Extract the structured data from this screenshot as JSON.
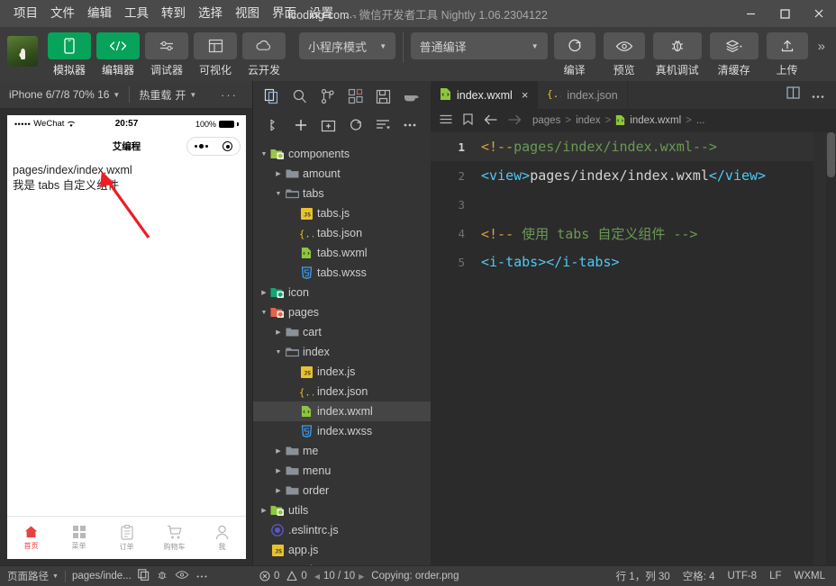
{
  "titlebar": {
    "menus": [
      "项目",
      "文件",
      "编辑",
      "工具",
      "转到",
      "选择",
      "视图",
      "界面",
      "设置"
    ],
    "menu_overflow": "...",
    "project": "icoding-com",
    "separator": "-",
    "app_name": "微信开发者工具",
    "channel": "Nightly",
    "version": "1.06.2304122",
    "minimize": "minimize-icon",
    "maximize": "maximize-icon",
    "close": "close-icon"
  },
  "toolbar": {
    "avatar": "user-avatar",
    "left_tools": [
      {
        "label": "模拟器",
        "icon": "phone-icon",
        "active": true
      },
      {
        "label": "编辑器",
        "icon": "code-icon",
        "active": true
      },
      {
        "label": "调试器",
        "icon": "debugger-icon",
        "active": false
      },
      {
        "label": "可视化",
        "icon": "layout-icon",
        "active": false
      },
      {
        "label": "云开发",
        "icon": "cloud-icon",
        "active": false
      }
    ],
    "mode_select": "小程序模式",
    "compile_select": "普通编译",
    "right_tools": [
      {
        "label": "编译",
        "icon": "refresh-icon"
      },
      {
        "label": "预览",
        "icon": "eye-icon"
      },
      {
        "label": "真机调试",
        "icon": "bug-icon"
      },
      {
        "label": "清缓存",
        "icon": "layers-icon"
      },
      {
        "label": "上传",
        "icon": "upload-icon"
      }
    ],
    "overflow": "»"
  },
  "simulator": {
    "device": "iPhone 6/7/8 70% 16",
    "hot_reload_label": "热重载",
    "hot_reload_value": "开",
    "more": "···",
    "phone": {
      "carrier": "WeChat",
      "signal_dots": "•••••",
      "time": "20:57",
      "battery": "100%",
      "nav_title": "艾编程",
      "content_lines": [
        "pages/index/index.wxml",
        "我是 tabs 自定义组件"
      ],
      "tabbar": [
        {
          "label": "首页",
          "icon": "home-icon",
          "active": true
        },
        {
          "label": "菜单",
          "icon": "grid-icon",
          "active": false
        },
        {
          "label": "订单",
          "icon": "clipboard-icon",
          "active": false
        },
        {
          "label": "购物车",
          "icon": "cart-icon",
          "active": false
        },
        {
          "label": "我",
          "icon": "person-icon",
          "active": false
        }
      ]
    }
  },
  "explorer": {
    "activity_icons": [
      "files-icon",
      "search-icon",
      "source-control-icon",
      "extensions-icon",
      "save-icon",
      "docker-icon"
    ],
    "operation_icons": [
      "new-file-icon",
      "add-icon",
      "new-folder-icon",
      "refresh-icon",
      "collapse-icon",
      "more-icon"
    ],
    "tree": [
      {
        "label": "components",
        "type": "folder-special",
        "depth": 0,
        "state": "open",
        "color": "#9ec34b"
      },
      {
        "label": "amount",
        "type": "folder",
        "depth": 1,
        "state": "closed",
        "color": "#8a9199"
      },
      {
        "label": "tabs",
        "type": "folder-open",
        "depth": 1,
        "state": "open",
        "color": "#8a9199"
      },
      {
        "label": "tabs.js",
        "type": "js",
        "depth": 2,
        "state": "leaf",
        "color": "#e8c22e"
      },
      {
        "label": "tabs.json",
        "type": "json",
        "depth": 2,
        "state": "leaf",
        "color": "#e8c22e"
      },
      {
        "label": "tabs.wxml",
        "type": "wxml",
        "depth": 2,
        "state": "leaf",
        "color": "#8dc63f"
      },
      {
        "label": "tabs.wxss",
        "type": "wxss",
        "depth": 2,
        "state": "leaf",
        "color": "#3c9ff0"
      },
      {
        "label": "icon",
        "type": "folder-special",
        "depth": 0,
        "state": "closed",
        "color": "#12a474"
      },
      {
        "label": "pages",
        "type": "folder-special",
        "depth": 0,
        "state": "open",
        "color": "#e2634a"
      },
      {
        "label": "cart",
        "type": "folder",
        "depth": 1,
        "state": "closed",
        "color": "#8a9199"
      },
      {
        "label": "index",
        "type": "folder-open",
        "depth": 1,
        "state": "open",
        "color": "#8a9199"
      },
      {
        "label": "index.js",
        "type": "js",
        "depth": 2,
        "state": "leaf",
        "color": "#e8c22e"
      },
      {
        "label": "index.json",
        "type": "json",
        "depth": 2,
        "state": "leaf",
        "color": "#e8c22e"
      },
      {
        "label": "index.wxml",
        "type": "wxml",
        "depth": 2,
        "state": "leaf",
        "color": "#8dc63f",
        "selected": true
      },
      {
        "label": "index.wxss",
        "type": "wxss",
        "depth": 2,
        "state": "leaf",
        "color": "#3c9ff0"
      },
      {
        "label": "me",
        "type": "folder",
        "depth": 1,
        "state": "closed",
        "color": "#8a9199"
      },
      {
        "label": "menu",
        "type": "folder",
        "depth": 1,
        "state": "closed",
        "color": "#8a9199"
      },
      {
        "label": "order",
        "type": "folder",
        "depth": 1,
        "state": "closed",
        "color": "#8a9199"
      },
      {
        "label": "utils",
        "type": "folder-special",
        "depth": 0,
        "state": "closed",
        "color": "#8dc63f"
      },
      {
        "label": ".eslintrc.js",
        "type": "eslint",
        "depth": 0,
        "state": "leaf",
        "color": "#5b57c4"
      },
      {
        "label": "app.js",
        "type": "js",
        "depth": 0,
        "state": "leaf",
        "color": "#e8c22e"
      },
      {
        "label": "app.json",
        "type": "json",
        "depth": 0,
        "state": "leaf",
        "color": "#e8c22e"
      }
    ]
  },
  "editor": {
    "tabs": [
      {
        "label": "index.wxml",
        "icon": "wxml-icon",
        "active": true,
        "close": "×"
      },
      {
        "label": "index.json",
        "icon": "json-icon",
        "active": false,
        "close": ""
      }
    ],
    "tab_actions": [
      "split-editor-icon",
      "more-actions-icon"
    ],
    "breadcrumb_icons": [
      "outline-icon",
      "bookmark-icon",
      "back-icon",
      "forward-icon"
    ],
    "breadcrumb": [
      "pages",
      "index",
      "index.wxml",
      "..."
    ],
    "lines": [
      {
        "num": "1",
        "tokens": [
          {
            "t": "<!--",
            "c": "t-commark"
          },
          {
            "t": "pages/index/index.wxml",
            "c": "t-comment"
          },
          {
            "t": "-->",
            "c": "t-comment"
          }
        ],
        "current": true
      },
      {
        "num": "2",
        "tokens": [
          {
            "t": "<view>",
            "c": "t-tag"
          },
          {
            "t": "pages/index/index.wxml",
            "c": "t-plain"
          },
          {
            "t": "</view>",
            "c": "t-tag"
          }
        ],
        "current": false
      },
      {
        "num": "3",
        "tokens": [],
        "current": false
      },
      {
        "num": "4",
        "tokens": [
          {
            "t": "<!--",
            "c": "t-commark"
          },
          {
            "t": " 使用 tabs 自定义组件 -->",
            "c": "t-comment"
          }
        ],
        "current": false
      },
      {
        "num": "5",
        "tokens": [
          {
            "t": "<i-tabs></i-tabs>",
            "c": "t-tag"
          }
        ],
        "current": false
      }
    ]
  },
  "statusbar": {
    "page_path_label": "页面路径",
    "page_path_value": "pages/inde...",
    "copy_icon": "copy-icon",
    "bug_icon": "bug-icon",
    "eye_icon": "eye-icon",
    "more_icon": "more-icon",
    "errors": "0",
    "warnings": "0",
    "pager": "10 / 10",
    "task": "Copying: order.png",
    "cursor": "行 1，列 30",
    "indent": "空格: 4",
    "encoding": "UTF-8",
    "eol": "LF",
    "language": "WXML"
  }
}
